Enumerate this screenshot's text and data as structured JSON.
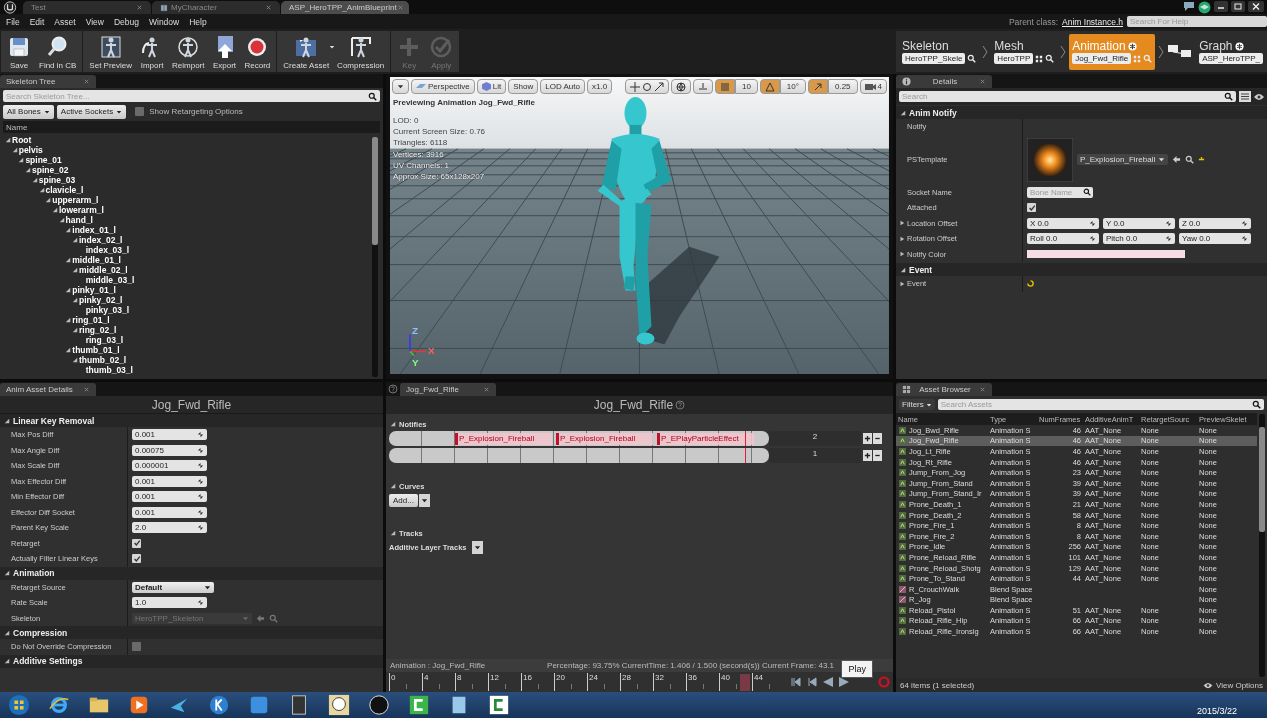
{
  "window_tabs": [
    {
      "label": "Test",
      "selected": false
    },
    {
      "label": "MyCharacter",
      "selected": false
    },
    {
      "label": "ASP_HeroTPP_AnimBlueprint",
      "selected": true
    }
  ],
  "menu": [
    "File",
    "Edit",
    "Asset",
    "View",
    "Debug",
    "Window",
    "Help"
  ],
  "parent_class": {
    "label": "Parent class:",
    "value": "Anim Instance.h"
  },
  "help_search": {
    "placeholder": "Search For Help"
  },
  "toolbar": [
    [
      {
        "label": "Save",
        "disabled": false
      },
      {
        "label": "Find in CB",
        "disabled": false
      }
    ],
    [
      {
        "label": "Set Preview",
        "disabled": false
      },
      {
        "label": "Import",
        "disabled": false
      },
      {
        "label": "Reimport",
        "disabled": false
      },
      {
        "label": "Export",
        "disabled": false
      },
      {
        "label": "Record",
        "disabled": false
      }
    ],
    [
      {
        "label": "Create Asset",
        "disabled": false
      },
      {
        "label": "Compression",
        "disabled": false
      }
    ],
    [
      {
        "label": "Key",
        "disabled": true
      },
      {
        "label": "Apply",
        "disabled": true
      }
    ]
  ],
  "modes": [
    {
      "label": "Skeleton",
      "asset": "HeroTPP_Skele",
      "selected": false
    },
    {
      "label": "Mesh",
      "asset": "HeroTPP",
      "selected": false
    },
    {
      "label": "Animation",
      "asset": "Jog_Fwd_Rifle",
      "selected": true
    },
    {
      "label": "Graph",
      "asset": "ASP_HeroTPP_",
      "selected": false
    }
  ],
  "skeleton_tree": {
    "tab": "Skeleton Tree",
    "search": {
      "placeholder": "Search Skeleton Tree..."
    },
    "filters": [
      "All Bones",
      "Active Sockets"
    ],
    "retarget_option": {
      "label": "Show Retargeting Options",
      "checked": false
    },
    "column": "Name",
    "bones": [
      {
        "name": "Root",
        "expanded": true,
        "children": [
          {
            "name": "pelvis",
            "expanded": true,
            "children": [
              {
                "name": "spine_01",
                "expanded": true,
                "children": [
                  {
                    "name": "spine_02",
                    "expanded": true,
                    "children": [
                      {
                        "name": "spine_03",
                        "expanded": true,
                        "children": [
                          {
                            "name": "clavicle_l",
                            "expanded": true,
                            "children": [
                              {
                                "name": "upperarm_l",
                                "expanded": true,
                                "children": [
                                  {
                                    "name": "lowerarm_l",
                                    "expanded": true,
                                    "children": [
                                      {
                                        "name": "hand_l",
                                        "expanded": true,
                                        "children": [
                                          {
                                            "name": "index_01_l",
                                            "expanded": true,
                                            "children": [
                                              {
                                                "name": "index_02_l",
                                                "expanded": true,
                                                "children": [
                                                  {
                                                    "name": "index_03_l"
                                                  }
                                                ]
                                              }
                                            ]
                                          },
                                          {
                                            "name": "middle_01_l",
                                            "expanded": true,
                                            "children": [
                                              {
                                                "name": "middle_02_l",
                                                "expanded": true,
                                                "children": [
                                                  {
                                                    "name": "middle_03_l"
                                                  }
                                                ]
                                              }
                                            ]
                                          },
                                          {
                                            "name": "pinky_01_l",
                                            "expanded": true,
                                            "children": [
                                              {
                                                "name": "pinky_02_l",
                                                "expanded": true,
                                                "children": [
                                                  {
                                                    "name": "pinky_03_l"
                                                  }
                                                ]
                                              }
                                            ]
                                          },
                                          {
                                            "name": "ring_01_l",
                                            "expanded": true,
                                            "children": [
                                              {
                                                "name": "ring_02_l",
                                                "expanded": true,
                                                "children": [
                                                  {
                                                    "name": "ring_03_l"
                                                  }
                                                ]
                                              }
                                            ]
                                          },
                                          {
                                            "name": "thumb_01_l",
                                            "expanded": true,
                                            "children": [
                                              {
                                                "name": "thumb_02_l",
                                                "expanded": true,
                                                "children": [
                                                  {
                                                    "name": "thumb_03_l"
                                                  }
                                                ]
                                              }
                                            ]
                                          }
                                        ]
                                      }
                                    ]
                                  }
                                ]
                              }
                            ]
                          }
                        ]
                      }
                    ]
                  }
                ]
              }
            ]
          }
        ]
      }
    ]
  },
  "viewport": {
    "buttons": [
      "Perspective",
      "Lit",
      "Show",
      "LOD Auto",
      "x1.0"
    ],
    "snaps": [
      {
        "value": "10",
        "on": true
      },
      {
        "value": "10°",
        "on": true
      },
      {
        "value": "0.25",
        "on": true
      }
    ],
    "camera_speed": "4",
    "title": "Previewing Animation Jog_Fwd_Rifle",
    "stats": [
      "LOD: 0",
      "Current Screen Size: 0.76",
      "Triangles: 6118",
      "Vertices: 3916",
      "UV Channels: 1",
      "Approx Size: 65x128x207"
    ],
    "axes": [
      "Z",
      "X",
      "Y"
    ]
  },
  "details": {
    "tab": "Details",
    "search": {
      "placeholder": "Search"
    },
    "sections": [
      {
        "title": "Anim Notify",
        "rows": [
          {
            "kind": "empty",
            "label": "Notify"
          },
          {
            "kind": "asset_thumb",
            "label": "PSTemplate",
            "value": "P_Explosion_Fireball"
          },
          {
            "kind": "search",
            "label": "Socket Name",
            "placeholder": "Bone Name"
          },
          {
            "kind": "check",
            "label": "Attached",
            "checked": true
          },
          {
            "kind": "vector",
            "label": "Location Offset",
            "expanded": false,
            "parts": [
              {
                "axis": "X",
                "value": "0.0"
              },
              {
                "axis": "Y",
                "value": "0.0"
              },
              {
                "axis": "Z",
                "value": "0.0"
              }
            ]
          },
          {
            "kind": "vector",
            "label": "Rotation Offset",
            "expanded": false,
            "parts": [
              {
                "axis": "Roll",
                "value": "0.0"
              },
              {
                "axis": "Pitch",
                "value": "0.0"
              },
              {
                "axis": "Yaw",
                "value": "0.0"
              }
            ]
          },
          {
            "kind": "color",
            "label": "Notify Color",
            "expanded": false,
            "color": "#f6dde5"
          }
        ]
      },
      {
        "title": "Event",
        "rows": [
          {
            "kind": "event",
            "label": "Event",
            "expanded": false
          }
        ]
      }
    ]
  },
  "anim_details": {
    "tab": "Anim Asset Details",
    "title": "Jog_Fwd_Rifle",
    "sections": [
      {
        "title": "Linear Key Removal",
        "rows": [
          {
            "kind": "number",
            "label": "Max Pos Diff",
            "value": "0.001"
          },
          {
            "kind": "number",
            "label": "Max Angle Diff",
            "value": "0.00075"
          },
          {
            "kind": "number",
            "label": "Max Scale Diff",
            "value": "0.000001"
          },
          {
            "kind": "number",
            "label": "Max Effector Diff",
            "value": "0.001"
          },
          {
            "kind": "number",
            "label": "Min Effector Diff",
            "value": "0.001"
          },
          {
            "kind": "number",
            "label": "Effector Diff Socket",
            "value": "0.001"
          },
          {
            "kind": "number",
            "label": "Parent Key Scale",
            "value": "2.0"
          },
          {
            "kind": "check",
            "label": "Retarget",
            "checked": true
          },
          {
            "kind": "check",
            "label": "Actually Filter Linear Keys",
            "checked": true
          }
        ]
      },
      {
        "title": "Animation",
        "rows": [
          {
            "kind": "select",
            "label": "Retarget Source",
            "value": "Default"
          },
          {
            "kind": "number",
            "label": "Rate Scale",
            "value": "1.0"
          },
          {
            "kind": "asset",
            "label": "Skeleton",
            "value": "HeroTPP_Skeleton",
            "disabled": true
          }
        ]
      },
      {
        "title": "Compression",
        "rows": [
          {
            "kind": "check",
            "label": "Do Not Override Compression",
            "checked": false
          }
        ]
      },
      {
        "title": "Additive Settings"
      }
    ]
  },
  "sequence": {
    "tab": "Jog_Fwd_Rifle",
    "title": "Jog_Fwd_Rifle",
    "notifies_label": "Notifies",
    "tracks": [
      {
        "number": "2",
        "notifies": [
          "P_Explosion_Fireball",
          "P_Explosion_Fireball",
          "P_EPlayParticleEffect"
        ]
      },
      {
        "number": "1"
      }
    ],
    "curves_label": "Curves",
    "add_button": "Add...",
    "tracks_label": "Tracks",
    "additive_label": "Additive Layer Tracks",
    "status_animation": "Animation :  Jog_Fwd_Rifle",
    "status_info": "Percentage:  93.75% CurrentTime:  1.406 / 1.500 (second(s)) Current Frame:  43.1",
    "ticks": [
      "0",
      "4",
      "8",
      "12",
      "16",
      "20",
      "24",
      "28",
      "32",
      "36",
      "40",
      "44"
    ],
    "playhead": {
      "level": 0.9375
    },
    "tooltip": "Play"
  },
  "asset_browser": {
    "tab": "Asset Browser",
    "filters": "Filters",
    "search": {
      "placeholder": "Search Assets"
    },
    "columns": [
      "Name",
      "Type",
      "NumFrames",
      "AdditiveAnimT",
      "RetargetSourc",
      "PreviewSkelet"
    ],
    "rows": [
      {
        "kind": "animation",
        "name": "Jog_Bwd_Rifle",
        "type": "Animation S",
        "frames": "46",
        "additive": "AAT_None",
        "retarget": "None",
        "preview": "None",
        "selected": false
      },
      {
        "kind": "animation",
        "name": "Jog_Fwd_Rifle",
        "type": "Animation S",
        "frames": "46",
        "additive": "AAT_None",
        "retarget": "None",
        "preview": "None",
        "selected": true
      },
      {
        "kind": "animation",
        "name": "Jog_Lt_Rifle",
        "type": "Animation S",
        "frames": "46",
        "additive": "AAT_None",
        "retarget": "None",
        "preview": "None",
        "selected": false
      },
      {
        "kind": "animation",
        "name": "Jog_Rt_Rifle",
        "type": "Animation S",
        "frames": "46",
        "additive": "AAT_None",
        "retarget": "None",
        "preview": "None",
        "selected": false
      },
      {
        "kind": "animation",
        "name": "Jump_From_Jog",
        "type": "Animation S",
        "frames": "23",
        "additive": "AAT_None",
        "retarget": "None",
        "preview": "None",
        "selected": false
      },
      {
        "kind": "animation",
        "name": "Jump_From_Stand",
        "type": "Animation S",
        "frames": "39",
        "additive": "AAT_None",
        "retarget": "None",
        "preview": "None",
        "selected": false
      },
      {
        "kind": "animation",
        "name": "Jump_From_Stand_Ir",
        "type": "Animation S",
        "frames": "39",
        "additive": "AAT_None",
        "retarget": "None",
        "preview": "None",
        "selected": false
      },
      {
        "kind": "animation",
        "name": "Prone_Death_1",
        "type": "Animation S",
        "frames": "21",
        "additive": "AAT_None",
        "retarget": "None",
        "preview": "None",
        "selected": false
      },
      {
        "kind": "animation",
        "name": "Prone_Death_2",
        "type": "Animation S",
        "frames": "58",
        "additive": "AAT_None",
        "retarget": "None",
        "preview": "None",
        "selected": false
      },
      {
        "kind": "animation",
        "name": "Prone_Fire_1",
        "type": "Animation S",
        "frames": "8",
        "additive": "AAT_None",
        "retarget": "None",
        "preview": "None",
        "selected": false
      },
      {
        "kind": "animation",
        "name": "Prone_Fire_2",
        "type": "Animation S",
        "frames": "8",
        "additive": "AAT_None",
        "retarget": "None",
        "preview": "None",
        "selected": false
      },
      {
        "kind": "animation",
        "name": "Prone_Idle",
        "type": "Animation S",
        "frames": "256",
        "additive": "AAT_None",
        "retarget": "None",
        "preview": "None",
        "selected": false
      },
      {
        "kind": "animation",
        "name": "Prone_Reload_Rifle",
        "type": "Animation S",
        "frames": "101",
        "additive": "AAT_None",
        "retarget": "None",
        "preview": "None",
        "selected": false
      },
      {
        "kind": "animation",
        "name": "Prone_Reload_Shotg",
        "type": "Animation S",
        "frames": "129",
        "additive": "AAT_None",
        "retarget": "None",
        "preview": "None",
        "selected": false
      },
      {
        "kind": "animation",
        "name": "Prone_To_Stand",
        "type": "Animation S",
        "frames": "44",
        "additive": "AAT_None",
        "retarget": "None",
        "preview": "None",
        "selected": false
      },
      {
        "kind": "blend_space",
        "name": "R_CrouchWalk",
        "type": "Blend Space",
        "preview": "None",
        "selected": false
      },
      {
        "kind": "blend_space",
        "name": "R_Jog",
        "type": "Blend Space",
        "preview": "None",
        "selected": false
      },
      {
        "kind": "animation",
        "name": "Reload_Pistol",
        "type": "Animation S",
        "frames": "51",
        "additive": "AAT_None",
        "retarget": "None",
        "preview": "None",
        "selected": false
      },
      {
        "kind": "animation",
        "name": "Reload_Rifle_Hip",
        "type": "Animation S",
        "frames": "66",
        "additive": "AAT_None",
        "retarget": "None",
        "preview": "None",
        "selected": false
      },
      {
        "kind": "animation",
        "name": "Reload_Rifle_Ironsig",
        "type": "Animation S",
        "frames": "66",
        "additive": "AAT_None",
        "retarget": "None",
        "preview": "None",
        "selected": false
      }
    ],
    "count": "64 items (1 selected)",
    "view_options": "View Options"
  },
  "taskbar": {
    "date": "2015/3/22"
  }
}
